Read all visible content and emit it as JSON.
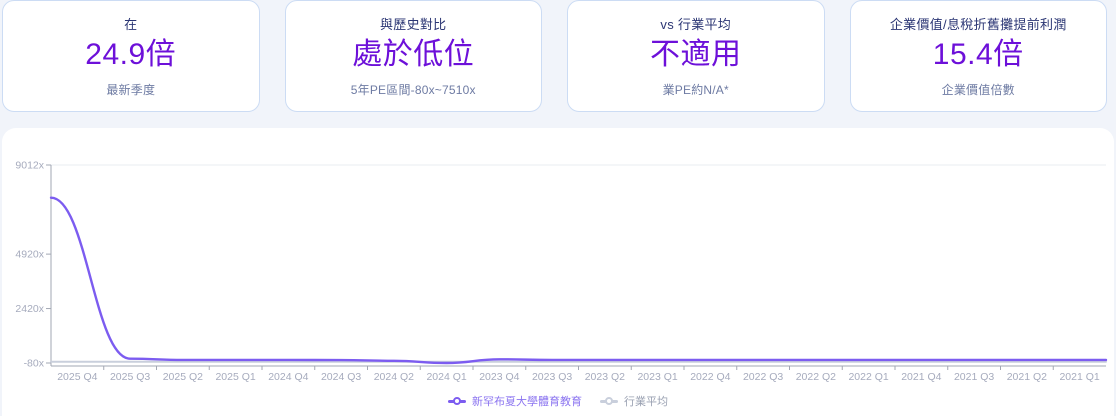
{
  "colors": {
    "page_background": "#f1f4fa",
    "card_background": "#ffffff",
    "card_border": "#ccdcf4",
    "title_text": "#2b3674",
    "subtitle_text": "#6e7ba3",
    "value_purple": "#6d10d9",
    "company_line": "#7c5cf0",
    "industry_line": "#c9cfdc",
    "legend_purple": "#8b74f0",
    "legend_gray": "#9aa1b2",
    "axis_line": "#a2a7b3",
    "tick_text": "#a6abbd",
    "grid_line": "#e9ecf2"
  },
  "cards": [
    {
      "title": "在",
      "value": "24.9倍",
      "subtitle": "最新季度"
    },
    {
      "title": "與歷史對比",
      "value": "處於低位",
      "subtitle": "5年PE區間-80x~7510x"
    },
    {
      "title": "vs 行業平均",
      "value": "不適用",
      "subtitle": "業PE約N/A*"
    },
    {
      "title": "企業價值/息稅折舊攤提前利潤",
      "value": "15.4倍",
      "subtitle": "企業價值倍數"
    }
  ],
  "chart_data": {
    "type": "line",
    "title": "",
    "xlabel": "",
    "ylabel": "",
    "categories": [
      "2025 Q4",
      "2025 Q3",
      "2025 Q2",
      "2025 Q1",
      "2024 Q4",
      "2024 Q3",
      "2024 Q2",
      "2024 Q1",
      "2023 Q4",
      "2023 Q3",
      "2023 Q2",
      "2023 Q1",
      "2022 Q4",
      "2022 Q3",
      "2022 Q2",
      "2022 Q1",
      "2021 Q4",
      "2021 Q3",
      "2021 Q2",
      "2021 Q1"
    ],
    "series": [
      {
        "name": "新罕布夏大學體育教育",
        "color": "#7c5cf0",
        "values": [
          7510,
          120,
          60,
          60,
          60,
          55,
          20,
          -80,
          90,
          60,
          60,
          60,
          60,
          60,
          60,
          60,
          60,
          60,
          60,
          60
        ]
      },
      {
        "name": "行業平均",
        "color": "#c9cfdc",
        "values": [
          -25,
          -25,
          -25,
          -25,
          -25,
          -25,
          -25,
          -25,
          -25,
          -25,
          -25,
          -25,
          -25,
          -25,
          -25,
          -25,
          -25,
          -25,
          -25,
          -25
        ]
      }
    ],
    "yticks": [
      {
        "label": "-80x",
        "value": -80
      },
      {
        "label": "2420x",
        "value": 2420
      },
      {
        "label": "4920x",
        "value": 4920
      },
      {
        "label": "9012x",
        "value": 9012
      }
    ],
    "ylim": [
      -80,
      9012
    ],
    "grid": "top horizontal gridline only",
    "legend_position": "bottom-center"
  }
}
